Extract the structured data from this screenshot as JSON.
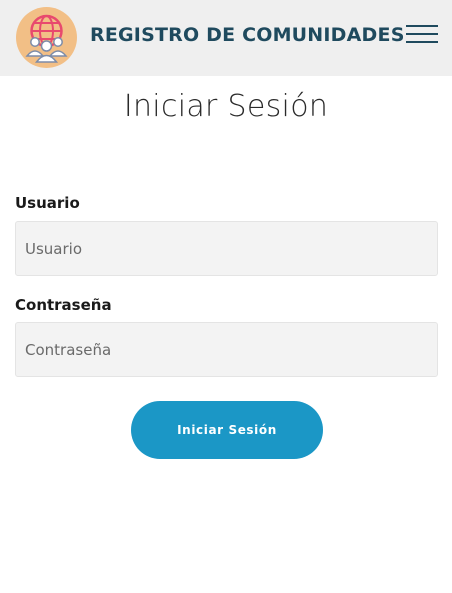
{
  "header": {
    "brand": "REGISTRO DE COMUNIDADES",
    "logo_icon": "globe-people-icon",
    "menu_icon": "hamburger-menu-icon"
  },
  "main": {
    "title": "Iniciar Sesión",
    "username": {
      "label": "Usuario",
      "placeholder": "Usuario",
      "value": ""
    },
    "password": {
      "label": "Contraseña",
      "placeholder": "Contraseña",
      "value": ""
    },
    "submit_label": "Iniciar Sesión"
  },
  "colors": {
    "header_bg": "#efefef",
    "brand_text": "#1f4a5e",
    "logo_bg": "#f2bf86",
    "button": "#1b97c6",
    "field_bg": "#f3f3f3"
  }
}
